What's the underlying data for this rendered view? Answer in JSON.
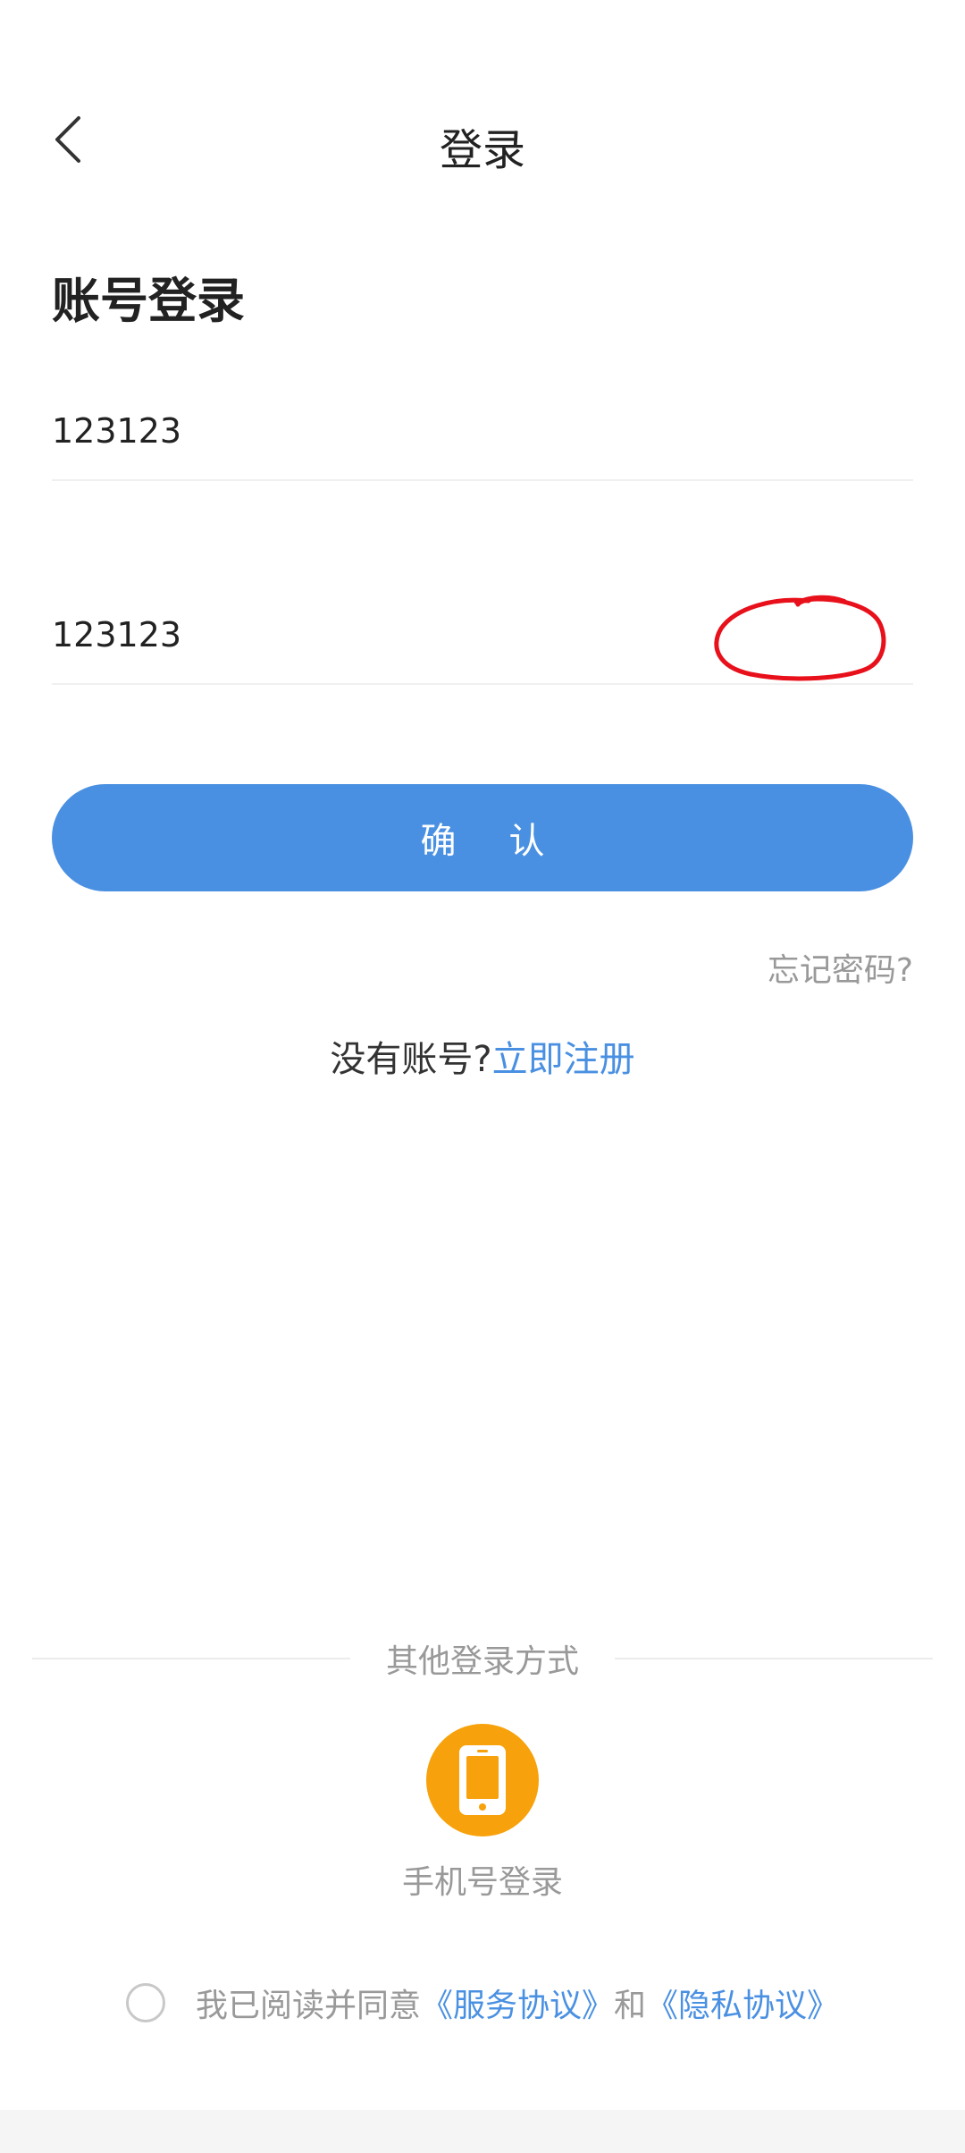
{
  "nav": {
    "title": "登录",
    "back_icon": "chevron-left-icon"
  },
  "heading": "账号登录",
  "account_field": {
    "value": "123123"
  },
  "password_field": {
    "value": "123123"
  },
  "confirm_button": {
    "label": "确 认",
    "color": "#4a90e2"
  },
  "forgot_link": "忘记密码?",
  "register": {
    "question": "没有账号?",
    "link": "立即注册"
  },
  "other_login": {
    "divider_label": "其他登录方式",
    "phone_login_label": "手机号登录",
    "phone_icon": "smartphone-icon",
    "icon_color": "#f7a20c"
  },
  "agreement": {
    "checked": false,
    "text_prefix": "我已阅读并同意",
    "service_link": "《服务协议》",
    "conjunction": "和",
    "privacy_link": "《隐私协议》"
  },
  "colors": {
    "accent": "#4a90e2",
    "annotation": "#e8101a"
  }
}
